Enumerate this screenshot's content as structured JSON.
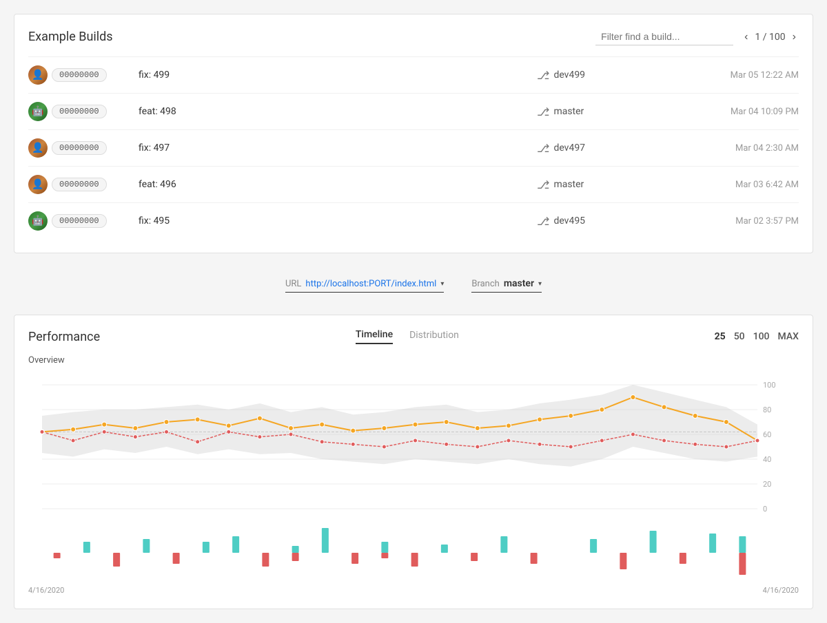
{
  "page": {
    "title": "Example Builds"
  },
  "builds_header": {
    "title": "Example Builds",
    "filter_placeholder": "Filter find a build...",
    "pagination_current": "1",
    "pagination_total": "100",
    "pagination_label": "1 / 100"
  },
  "builds": [
    {
      "id": "00000000",
      "message": "fix: 499",
      "branch": "dev499",
      "date": "Mar 05 12:22 AM",
      "avatar_class": "avatar-0",
      "avatar_glyph": "👤"
    },
    {
      "id": "00000000",
      "message": "feat: 498",
      "branch": "master",
      "date": "Mar 04 10:09 PM",
      "avatar_class": "avatar-1",
      "avatar_glyph": "🤖"
    },
    {
      "id": "00000000",
      "message": "fix: 497",
      "branch": "dev497",
      "date": "Mar 04 2:30 AM",
      "avatar_class": "avatar-2",
      "avatar_glyph": "👤"
    },
    {
      "id": "00000000",
      "message": "feat: 496",
      "branch": "master",
      "date": "Mar 03 6:42 AM",
      "avatar_class": "avatar-3",
      "avatar_glyph": "👤"
    },
    {
      "id": "00000000",
      "message": "fix: 495",
      "branch": "dev495",
      "date": "Mar 02 3:57 PM",
      "avatar_class": "avatar-4",
      "avatar_glyph": "🤖"
    }
  ],
  "filter_bar": {
    "url_label": "URL",
    "url_value": "http://localhost:PORT/index.html",
    "branch_label": "Branch",
    "branch_value": "master"
  },
  "performance": {
    "title": "Performance",
    "tabs": [
      {
        "label": "Timeline",
        "active": true
      },
      {
        "label": "Distribution",
        "active": false
      }
    ],
    "counts": [
      "25",
      "50",
      "100",
      "MAX"
    ],
    "active_count": "25",
    "overview_label": "Overview",
    "y_axis_labels": [
      "100",
      "80",
      "60",
      "40",
      "20",
      "0"
    ],
    "date_start": "4/16/2020",
    "date_end": "4/16/2020"
  }
}
